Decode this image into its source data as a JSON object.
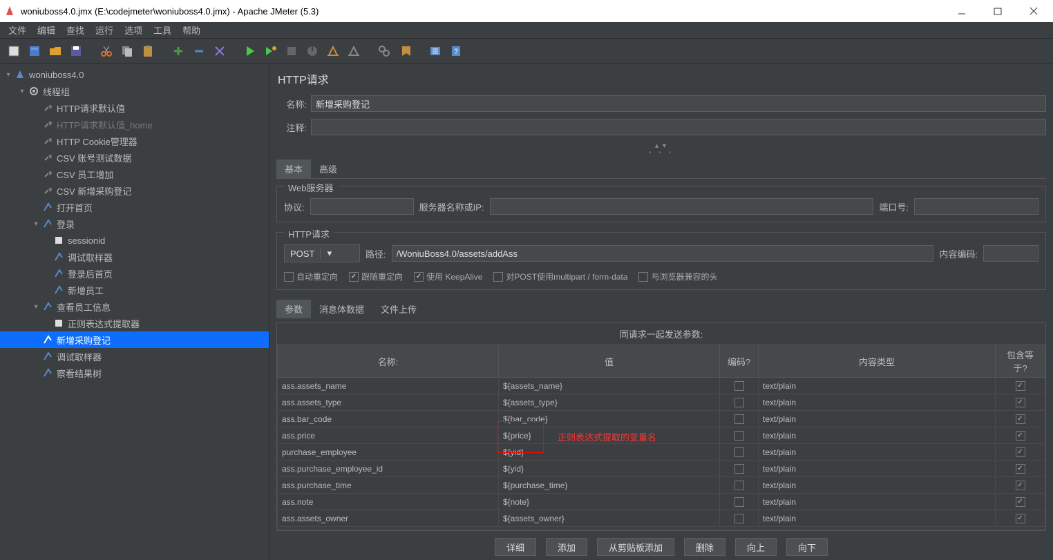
{
  "title": "woniuboss4.0.jmx (E:\\codejmeter\\woniuboss4.0.jmx) - Apache JMeter (5.3)",
  "menu": {
    "file": "文件",
    "edit": "编辑",
    "search": "查找",
    "run": "运行",
    "options": "选项",
    "tools": "工具",
    "help": "帮助"
  },
  "tree": {
    "root": "woniuboss4.0",
    "threadgroup": "线程组",
    "items": [
      "HTTP请求默认值",
      "HTTP请求默认值_home",
      "HTTP Cookie管理器",
      "CSV 账号测试数据",
      "CSV 员工增加",
      "CSV 新增采购登记",
      "打开首页"
    ],
    "login": "登录",
    "login_children": [
      "sessionid",
      "调试取样器",
      "登录后首页",
      "新增员工"
    ],
    "view_emp": "查看员工信息",
    "view_emp_children": [
      "正则表达式提取器"
    ],
    "selected": "新增采购登记",
    "after": [
      "调试取样器",
      "察看结果树"
    ]
  },
  "panel": {
    "title": "HTTP请求",
    "name_label": "名称:",
    "name_value": "新增采购登记",
    "comment_label": "注释:",
    "comment_value": "",
    "tab_basic": "基本",
    "tab_advanced": "高级",
    "webserver": {
      "title": "Web服务器",
      "protocol_label": "协议:",
      "protocol_value": "",
      "server_label": "服务器名称或IP:",
      "server_value": "",
      "port_label": "端口号:",
      "port_value": ""
    },
    "httpreq": {
      "title": "HTTP请求",
      "method": "POST",
      "path_label": "路径:",
      "path_value": "/WoniuBoss4.0/assets/addAss",
      "encoding_label": "内容编码:",
      "encoding_value": "",
      "cb_autoredirect": "自动重定向",
      "cb_followredirect": "跟随重定向",
      "cb_keepalive": "使用 KeepAlive",
      "cb_multipart": "对POST使用multipart / form-data",
      "cb_browser": "与浏览器兼容的头"
    },
    "subtabs": {
      "params": "参数",
      "body": "消息体数据",
      "file": "文件上传"
    },
    "params": {
      "header": "同请求一起发送参数:",
      "cols": {
        "name": "名称:",
        "value": "值",
        "encode": "编码?",
        "type": "内容类型",
        "include": "包含等于?"
      },
      "rows": [
        {
          "name": "ass.assets_name",
          "value": "${assets_name}",
          "encode": false,
          "type": "text/plain",
          "include": true
        },
        {
          "name": "ass.assets_type",
          "value": "${assets_type}",
          "encode": false,
          "type": "text/plain",
          "include": true
        },
        {
          "name": "ass.bar_code",
          "value": "${bar_code}",
          "encode": false,
          "type": "text/plain",
          "include": true
        },
        {
          "name": "ass.price",
          "value": "${price}",
          "encode": false,
          "type": "text/plain",
          "include": true
        },
        {
          "name": "purchase_employee",
          "value": "${yid}",
          "encode": false,
          "type": "text/plain",
          "include": true
        },
        {
          "name": "ass.purchase_employee_id",
          "value": "${yid}",
          "encode": false,
          "type": "text/plain",
          "include": true
        },
        {
          "name": "ass.purchase_time",
          "value": "${purchase_time}",
          "encode": false,
          "type": "text/plain",
          "include": true
        },
        {
          "name": "ass.note",
          "value": "${note}",
          "encode": false,
          "type": "text/plain",
          "include": true
        },
        {
          "name": "ass.assets_owner",
          "value": "${assets_owner}",
          "encode": false,
          "type": "text/plain",
          "include": true
        }
      ]
    },
    "annotation_text": "正则表达式提取的变量名",
    "buttons": {
      "detail": "详细",
      "add": "添加",
      "clipboard": "从剪贴板添加",
      "delete": "删除",
      "up": "向上",
      "down": "向下"
    }
  }
}
